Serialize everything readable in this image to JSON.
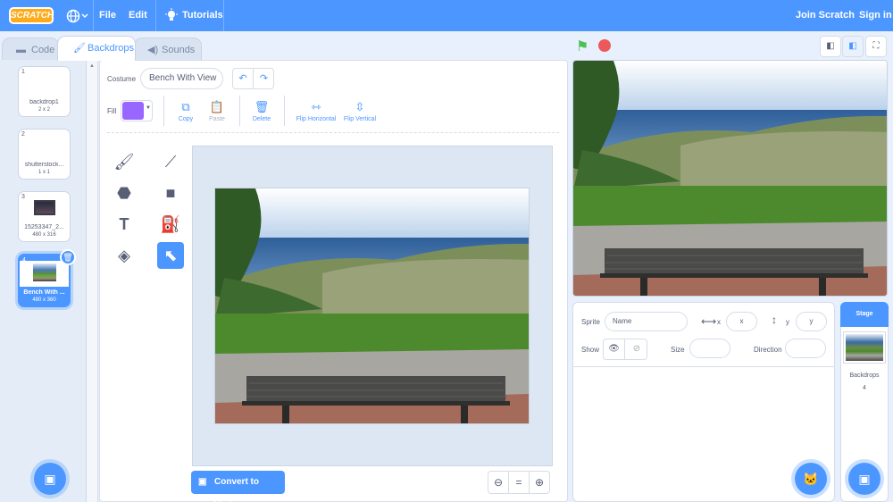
{
  "menu": {
    "logo": "SCRATCH",
    "file": "File",
    "edit": "Edit",
    "tutorials": "Tutorials",
    "join": "Join Scratch",
    "signin": "Sign in"
  },
  "tabs": {
    "code": "Code",
    "backdrops": "Backdrops",
    "sounds": "Sounds"
  },
  "backdrops": [
    {
      "num": "1",
      "name": "backdrop1",
      "size": "2 x 2"
    },
    {
      "num": "2",
      "name": "shutterstock...",
      "size": "1 x 1"
    },
    {
      "num": "3",
      "name": "15253347_2...",
      "size": "480 x 316"
    },
    {
      "num": "4",
      "name": "Bench With ...",
      "size": "480 x 360"
    }
  ],
  "editor": {
    "costume_label": "Costume",
    "costume_name": "Bench With View",
    "fill_label": "Fill",
    "fill_color": "#9966ff",
    "copy": "Copy",
    "paste": "Paste",
    "delete": "Delete",
    "flip_h": "Flip Horizontal",
    "flip_v": "Flip Vertical",
    "convert": "Convert to Vector"
  },
  "sprite": {
    "sprite_label": "Sprite",
    "name_placeholder": "Name",
    "x_label": "x",
    "x_placeholder": "x",
    "y_label": "y",
    "y_placeholder": "y",
    "show_label": "Show",
    "size_label": "Size",
    "direction_label": "Direction"
  },
  "stage": {
    "header": "Stage",
    "backdrops_label": "Backdrops",
    "backdrops_count": "4"
  },
  "colors": {
    "accent": "#4c97ff",
    "flag": "#4cbf56",
    "stop": "#ec5959",
    "logo": "#ffab19"
  }
}
